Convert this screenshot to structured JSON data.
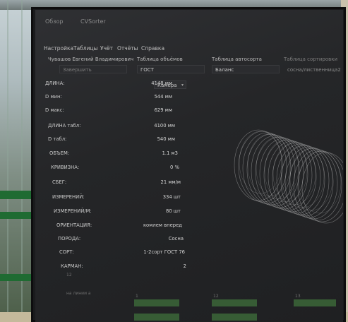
{
  "topbar": {
    "item1": "Обзор",
    "app_title": "CVSorter"
  },
  "menu": {
    "items": [
      "Настройка",
      "Таблицы",
      "Учёт",
      "Отчёты",
      "Справка"
    ]
  },
  "header": {
    "operator": "Чувашов Евгений Владимирович",
    "volume_table_label": "Таблица объёмов",
    "autosort_table_label": "Таблица автосорта",
    "sort_table_label": "Таблица сортировки"
  },
  "fields": {
    "operator_button": "Завершить",
    "volume_table_value": "ГОСТ",
    "autosort_table_value": "Баланс",
    "sort_table_value": "сосна/лиственница2"
  },
  "camera_select": {
    "value": "Камера"
  },
  "params": [
    {
      "label": "ДЛИНА:",
      "value": "4148 мм"
    },
    {
      "label": "D мин:",
      "value": "544 мм"
    },
    {
      "label": "D макс:",
      "value": "629 мм"
    },
    {
      "label": "ДЛИНА табл:",
      "value": "4100 мм"
    },
    {
      "label": "D табл:",
      "value": "540 мм"
    },
    {
      "label": "ОБЪЕМ:",
      "value": "1.1 м3"
    },
    {
      "label": "КРИВИЗНА:",
      "value": "0 %"
    },
    {
      "label": "СБЕГ:",
      "value": "21 мм/м"
    },
    {
      "label": "ИЗМЕРЕНИЙ:",
      "value": "334 шт"
    },
    {
      "label": "ИЗМЕРЕНИЙ/М:",
      "value": "80 шт"
    },
    {
      "label": "ОРИЕНТАЦИЯ:",
      "value": "комлем вперед"
    },
    {
      "label": "ПОРОДА:",
      "value": "Сосна"
    },
    {
      "label": "СОРТ:",
      "value": "1-2сорт ГОСТ 76"
    },
    {
      "label": "КАРМАН:",
      "value": "2"
    }
  ],
  "footer": {
    "pocket_sub": "12",
    "sorting_label": "на линии а"
  },
  "bars": [
    {
      "label": "1",
      "level": 0.8
    },
    {
      "label": "12",
      "level": 0.6
    },
    {
      "label": "13",
      "level": 0.5
    }
  ],
  "colors": {
    "screen_bg": "#252628",
    "text": "#c8c8c8",
    "bar_green": "#3d6b3a"
  }
}
